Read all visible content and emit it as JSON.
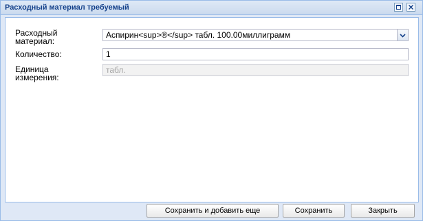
{
  "window": {
    "title": "Расходный материал требуемый",
    "icons": {
      "restore": "restore-icon",
      "close": "close-icon"
    }
  },
  "form": {
    "material": {
      "label_line1": "Расходный",
      "label_line2": "материал:",
      "value": "Аспирин<sup>®</sup>  табл.  100.00миллиграмм",
      "trigger_icon": "chevron-down-icon"
    },
    "quantity": {
      "label": "Количество:",
      "value": "1"
    },
    "unit": {
      "label_line1": "Единица",
      "label_line2": "измерения:",
      "value": "табл."
    }
  },
  "buttons": {
    "save_and_add": "Сохранить и добавить еще",
    "save": "Сохранить",
    "close": "Закрыть"
  },
  "colors": {
    "title_text": "#15428b",
    "border": "#99bbe8",
    "frame_bg": "#dfe8f6"
  }
}
